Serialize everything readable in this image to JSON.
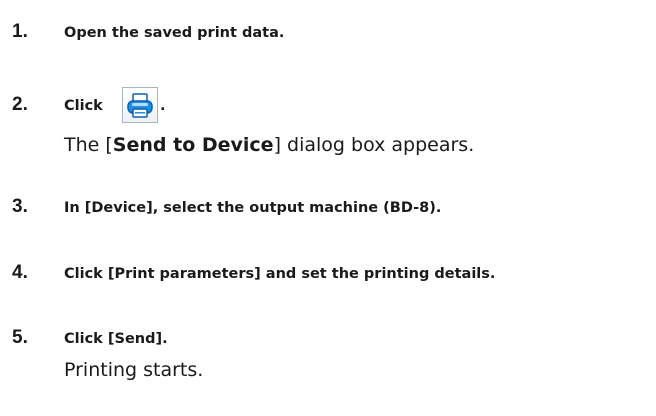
{
  "steps": [
    {
      "number": "1.",
      "text": "Open the saved print data."
    },
    {
      "number": "2.",
      "text_before": "Click",
      "icon": "printer-icon",
      "text_after": ".",
      "result_prefix": "The [",
      "result_bold": "Send to Device",
      "result_suffix": "] dialog box appears."
    },
    {
      "number": "3.",
      "text": "In [Device], select the output machine (BD-8)."
    },
    {
      "number": "4.",
      "text": "Click [Print parameters] and set the printing details."
    },
    {
      "number": "5.",
      "text": "Click [Send].",
      "result": "Printing starts."
    }
  ],
  "colors": {
    "icon_blue": "#1f8fe0",
    "icon_dark_blue": "#0b5fb8",
    "icon_light": "#d9efff"
  }
}
